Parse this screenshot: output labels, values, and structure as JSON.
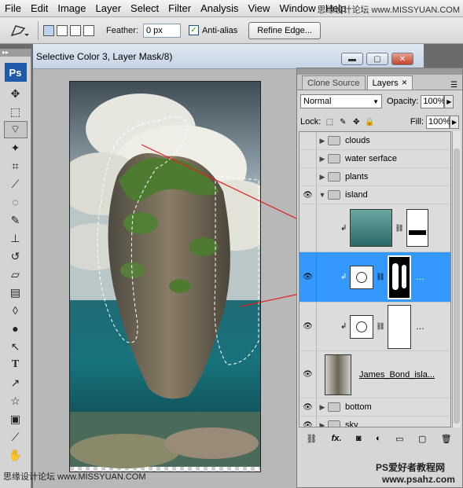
{
  "menu": [
    "File",
    "Edit",
    "Image",
    "Layer",
    "Select",
    "Filter",
    "Analysis",
    "View",
    "Window",
    "Help"
  ],
  "watermark_top": "思缘设计论坛  www.MISSYUAN.COM",
  "watermark_bottom_left": "思缘设计论坛  www.MISSYUAN.COM",
  "watermark_bottom_right_1": "PS爱好者教程网",
  "watermark_bottom_right_2": "www.psahz.com",
  "options": {
    "feather_label": "Feather:",
    "feather_value": "0 px",
    "antialias_label": "Anti-alias",
    "refine_edge": "Refine Edge..."
  },
  "toolbox": {
    "logo": "Ps",
    "tools": [
      "move-icon",
      "marquee-icon",
      "lasso-icon",
      "magic-wand-icon",
      "crop-icon",
      "eyedropper-icon",
      "healing-icon",
      "brush-icon",
      "stamp-icon",
      "history-brush-icon",
      "eraser-icon",
      "gradient-icon",
      "blur-icon",
      "dodge-icon",
      "path-select-icon",
      "type-icon",
      "pen-icon",
      "shape-icon",
      "notes-icon",
      "eyedropper2-icon",
      "hand-icon",
      "zoom-icon"
    ]
  },
  "document": {
    "title": "Selective Color 3, Layer Mask/8)"
  },
  "layers_panel": {
    "tabs": [
      "Clone Source",
      "Layers"
    ],
    "blend_mode": "Normal",
    "opacity_label": "Opacity:",
    "opacity_value": "100%",
    "lock_label": "Lock:",
    "fill_label": "Fill:",
    "fill_value": "100%",
    "layers": [
      {
        "name": "clouds",
        "type": "group",
        "visible": false
      },
      {
        "name": "water serface",
        "type": "group",
        "visible": false
      },
      {
        "name": "plants",
        "type": "group",
        "visible": false
      },
      {
        "name": "island",
        "type": "group",
        "visible": true,
        "expanded": true
      },
      {
        "name": "",
        "type": "adjustment-photo",
        "visible": false
      },
      {
        "name": "",
        "type": "adjustment-selected",
        "visible": true
      },
      {
        "name": "",
        "type": "adjustment",
        "visible": true
      },
      {
        "name": "James_Bond_isla...",
        "type": "pixel",
        "visible": true
      },
      {
        "name": "bottom",
        "type": "group",
        "visible": true
      },
      {
        "name": "sky",
        "type": "group",
        "visible": true
      }
    ]
  },
  "colors": {
    "selection_highlight": "#3399ff",
    "annotation_line": "#e02020"
  }
}
